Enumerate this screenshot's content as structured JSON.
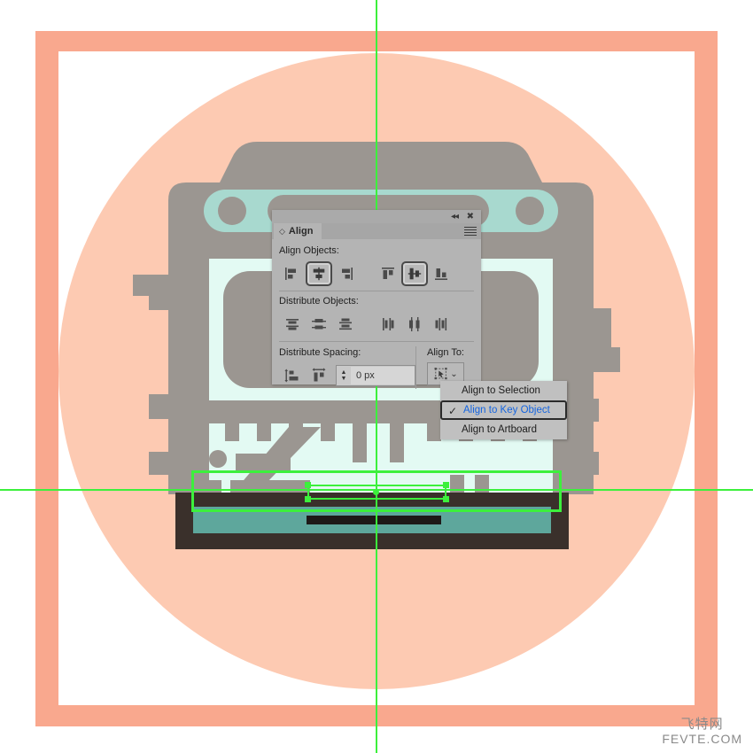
{
  "artwork": {
    "frame_color": "#f9a88e",
    "circle_color": "#fdcab2",
    "inner_white": "#ffffff",
    "machine_gray": "#9b9691",
    "machine_mint": "#e3faf3",
    "machine_teal": "#a8d9cf",
    "machine_dark": "#3a302b",
    "machine_slot": "#5ea79c",
    "guide_color": "#3cf03c",
    "selection_color": "#3cf03c"
  },
  "panel": {
    "titlebar": {
      "collapse_icon": "collapse-double-left-icon",
      "close_icon": "close-icon"
    },
    "tab": {
      "label": "Align",
      "diamond_icon": "diamond-toggle-icon",
      "menu_icon": "panel-menu-icon"
    },
    "align_objects": {
      "label": "Align Objects:",
      "buttons": [
        {
          "name": "horizontal-align-left",
          "icon": "align-left-icon",
          "selected": false
        },
        {
          "name": "horizontal-align-center",
          "icon": "align-hcenter-icon",
          "selected": true
        },
        {
          "name": "horizontal-align-right",
          "icon": "align-right-icon",
          "selected": false
        },
        {
          "name": "vertical-align-top",
          "icon": "align-top-icon",
          "selected": false
        },
        {
          "name": "vertical-align-center",
          "icon": "align-vcenter-icon",
          "selected": true
        },
        {
          "name": "vertical-align-bottom",
          "icon": "align-bottom-icon",
          "selected": false
        }
      ]
    },
    "distribute_objects": {
      "label": "Distribute Objects:",
      "buttons": [
        {
          "name": "vertical-distribute-top",
          "icon": "dist-top-icon"
        },
        {
          "name": "vertical-distribute-center",
          "icon": "dist-vcenter-icon"
        },
        {
          "name": "vertical-distribute-bottom",
          "icon": "dist-bottom-icon"
        },
        {
          "name": "horizontal-distribute-left",
          "icon": "dist-left-icon"
        },
        {
          "name": "horizontal-distribute-center",
          "icon": "dist-hcenter-icon"
        },
        {
          "name": "horizontal-distribute-right",
          "icon": "dist-right-icon"
        }
      ]
    },
    "distribute_spacing": {
      "label": "Distribute Spacing:",
      "buttons": [
        {
          "name": "vertical-distribute-space",
          "icon": "vspace-icon"
        },
        {
          "name": "horizontal-distribute-space",
          "icon": "hspace-icon"
        }
      ],
      "value": "0 px",
      "stepper_up": "▲",
      "stepper_down": "▼"
    },
    "align_to": {
      "label": "Align To:",
      "button_icon": "align-to-key-object-icon",
      "chevron": "⌄"
    }
  },
  "dropdown": {
    "items": [
      {
        "label": "Align to Selection",
        "checked": false
      },
      {
        "label": "Align to Key Object",
        "checked": true
      },
      {
        "label": "Align to Artboard",
        "checked": false
      }
    ],
    "check_glyph": "✓"
  },
  "watermark": {
    "cn": "飞特网",
    "en": "FEVTE.COM"
  }
}
